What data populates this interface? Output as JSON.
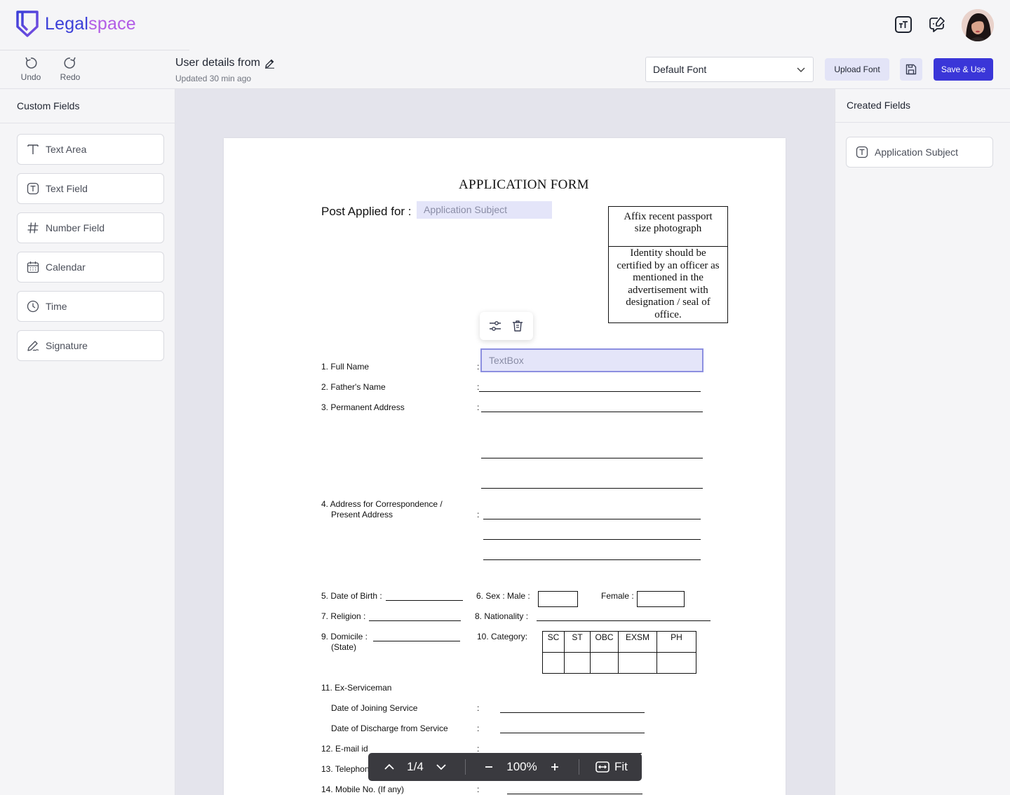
{
  "brand": {
    "name_part1": "Legal",
    "name_part2": "space"
  },
  "header": {
    "text_tool_icon": "text-size-icon",
    "comment_icon": "comment-edit-icon",
    "avatar": "user-avatar"
  },
  "toolbar": {
    "undo_label": "Undo",
    "redo_label": "Redo",
    "doc_title": "User details from",
    "updated": "Updated 30 min ago",
    "font_select": "Default Font",
    "upload_font": "Upload Font",
    "save_use": "Save & Use"
  },
  "left_panel": {
    "title": "Custom Fields",
    "items": [
      {
        "label": "Text Area",
        "icon": "text-area-icon"
      },
      {
        "label": "Text Field",
        "icon": "text-field-icon"
      },
      {
        "label": "Number Field",
        "icon": "hash-icon"
      },
      {
        "label": "Calendar",
        "icon": "calendar-icon"
      },
      {
        "label": "Time",
        "icon": "clock-icon"
      },
      {
        "label": "Signature",
        "icon": "signature-icon"
      }
    ]
  },
  "right_panel": {
    "title": "Created Fields",
    "items": [
      {
        "label": "Application Subject",
        "icon": "text-field-icon"
      }
    ]
  },
  "document": {
    "title": "APPLICATION FORM",
    "post_label": "Post Applied for  :",
    "post_field_placeholder": "Application Subject",
    "photo_top": "Affix recent passport\nsize photograph",
    "photo_bottom": "Identity should be\ncertified by an officer as\nmentioned in the\nadvertisement with\ndesignation / seal of\noffice.",
    "textbox_placeholder": "TextBox",
    "fields": {
      "full_name": "1. Full Name",
      "father": "2. Father's Name",
      "permanent": "3. Permanent Address",
      "correspondence_1": "4. Address for Correspondence /",
      "correspondence_2": "Present Address",
      "dob": "5. Date of Birth :",
      "sex": "6.  Sex : Male :",
      "female": "Female :",
      "religion": "7. Religion :",
      "nationality": "8.   Nationality :",
      "domicile_1": "9. Domicile :",
      "domicile_2": "(State)",
      "category": "10.   Category:",
      "ex_serviceman": "11. Ex-Serviceman",
      "joining": "Date of Joining Service",
      "discharge": "Date of Discharge from Service",
      "email": "12. E-mail id",
      "telephone": "13. Telephon",
      "mobile": "14. Mobile No.   (If any)"
    },
    "colon": ":",
    "categories": [
      "SC",
      "ST",
      "OBC",
      "EXSM",
      "PH"
    ]
  },
  "pager": {
    "page": "1/4",
    "zoom": "100%",
    "fit": "Fit"
  },
  "colors": {
    "accent": "#3a36d8",
    "brand_blue": "#3b3fd8",
    "brand_purple": "#b25ce6",
    "field_fill": "#e4e5f9"
  }
}
